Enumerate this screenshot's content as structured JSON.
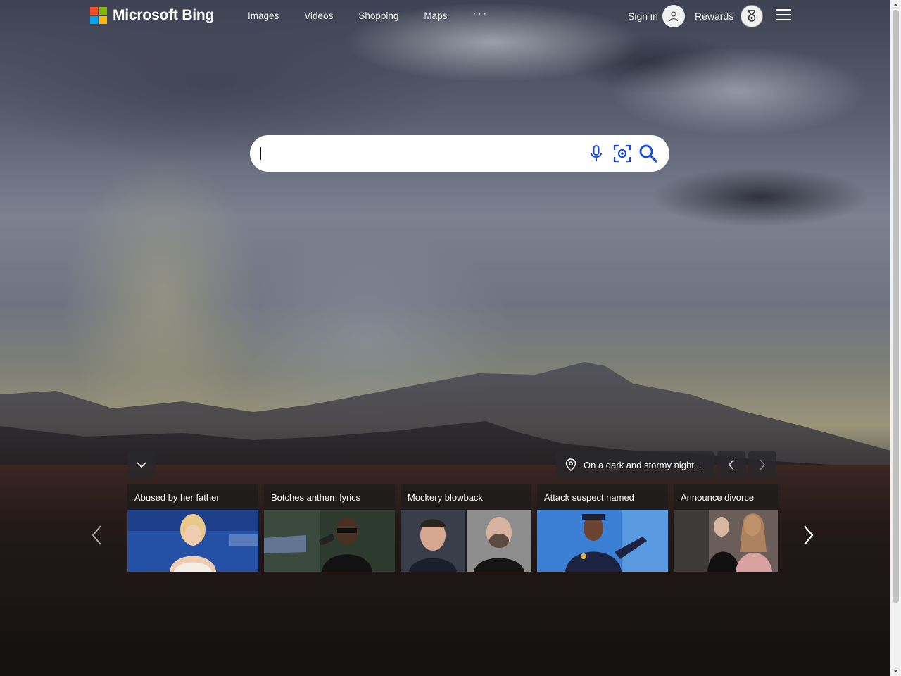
{
  "header": {
    "brand": "Microsoft Bing",
    "nav": [
      "Images",
      "Videos",
      "Shopping",
      "Maps"
    ],
    "more": "···",
    "signin_label": "Sign in",
    "rewards_label": "Rewards"
  },
  "search": {
    "value": "",
    "placeholder": "",
    "icons": [
      "microphone-icon",
      "visual-search-icon",
      "search-icon"
    ]
  },
  "image_info": {
    "caption": "On a dark and stormy night..."
  },
  "news": [
    {
      "title": "Abused by her father"
    },
    {
      "title": "Botches anthem lyrics"
    },
    {
      "title": "Mockery blowback"
    },
    {
      "title": "Attack suspect named"
    },
    {
      "title": "Announce divorce"
    }
  ],
  "colors": {
    "ms_red": "#f25022",
    "ms_green": "#7fba00",
    "ms_blue": "#00a4ef",
    "ms_yellow": "#ffb900",
    "search_icon_blue": "#174ae4",
    "card_bg": "#1e1c1c"
  }
}
